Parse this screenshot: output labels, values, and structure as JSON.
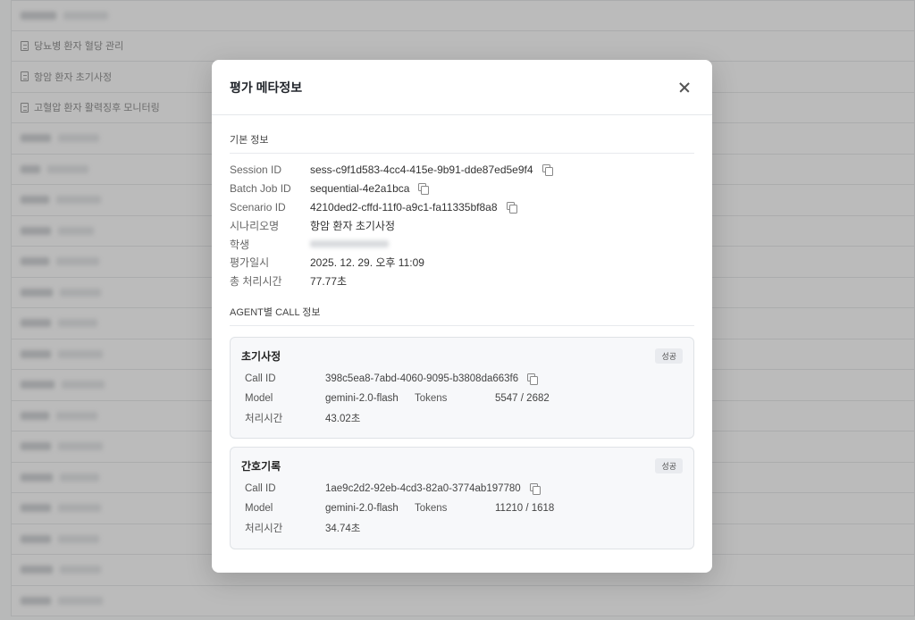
{
  "background": {
    "rows": [
      {
        "type": "blur",
        "w1": 40,
        "w2": 50
      },
      {
        "type": "doc",
        "label": "당뇨병 환자 혈당 관리"
      },
      {
        "type": "doc",
        "label": "항암 환자 초기사정"
      },
      {
        "type": "doc",
        "label": "고혈압 환자 활력징후 모니터링"
      },
      {
        "type": "blur",
        "w1": 34,
        "w2": 46
      },
      {
        "type": "blur",
        "w1": 22,
        "w2": 46
      },
      {
        "type": "blur",
        "w1": 32,
        "w2": 50
      },
      {
        "type": "blur",
        "w1": 34,
        "w2": 40
      },
      {
        "type": "blur",
        "w1": 32,
        "w2": 48
      },
      {
        "type": "blur",
        "w1": 36,
        "w2": 46
      },
      {
        "type": "blur",
        "w1": 34,
        "w2": 44
      },
      {
        "type": "blur",
        "w1": 34,
        "w2": 50
      },
      {
        "type": "blur",
        "w1": 38,
        "w2": 48
      },
      {
        "type": "blur",
        "w1": 32,
        "w2": 46
      },
      {
        "type": "blur",
        "w1": 34,
        "w2": 50
      },
      {
        "type": "blur",
        "w1": 36,
        "w2": 44
      },
      {
        "type": "blur",
        "w1": 34,
        "w2": 48
      },
      {
        "type": "blur",
        "w1": 34,
        "w2": 46
      },
      {
        "type": "blur",
        "w1": 36,
        "w2": 46
      },
      {
        "type": "blur",
        "w1": 34,
        "w2": 50
      }
    ]
  },
  "modal": {
    "title": "평가 메타정보",
    "basic_section": "기본 정보",
    "fields": [
      {
        "key": "Session ID",
        "value": "sess-c9f1d583-4cc4-415e-9b91-dde87ed5e9f4",
        "copy": true
      },
      {
        "key": "Batch Job ID",
        "value": "sequential-4e2a1bca",
        "copy": true
      },
      {
        "key": "Scenario ID",
        "value": "4210ded2-cffd-11f0-a9c1-fa11335bf8a8",
        "copy": true
      },
      {
        "key": "시나리오명",
        "value": "항암 환자 초기사정",
        "copy": false
      },
      {
        "key": "학생",
        "value": "",
        "copy": false,
        "blurred": true
      },
      {
        "key": "평가일시",
        "value": "2025. 12. 29. 오후 11:09",
        "copy": false
      },
      {
        "key": "총 처리시간",
        "value": "77.77초",
        "copy": false
      }
    ],
    "agent_section": "AGENT별 CALL 정보",
    "agents": [
      {
        "name": "초기사정",
        "status": "성공",
        "call_id_label": "Call ID",
        "call_id": "398c5ea8-7abd-4060-9095-b3808da663f6",
        "model_label": "Model",
        "model": "gemini-2.0-flash",
        "tokens_label": "Tokens",
        "tokens": "5547 / 2682",
        "time_label": "처리시간",
        "time": "43.02초"
      },
      {
        "name": "간호기록",
        "status": "성공",
        "call_id_label": "Call ID",
        "call_id": "1ae9c2d2-92eb-4cd3-82a0-3774ab197780",
        "model_label": "Model",
        "model": "gemini-2.0-flash",
        "tokens_label": "Tokens",
        "tokens": "11210 / 1618",
        "time_label": "처리시간",
        "time": "34.74초"
      }
    ]
  }
}
